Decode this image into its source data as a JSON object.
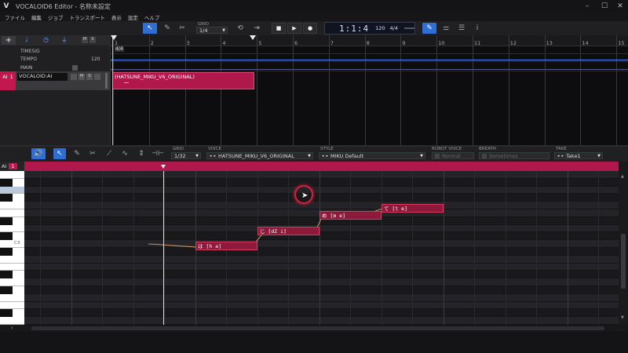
{
  "window": {
    "title": "VOCALOID6 Editor - 名称未設定",
    "logo": "V"
  },
  "menu": [
    "ファイル",
    "編集",
    "ジョブ",
    "トランスポート",
    "表示",
    "設定",
    "ヘルプ"
  ],
  "toolbar": {
    "grid_label": "GRID",
    "grid_value": "1/4",
    "position": "1:1:4",
    "tempo": "120",
    "timesig": "4/4"
  },
  "tracks_panel": {
    "add_label": "+",
    "timesig_label": "TIMESIG",
    "tempo_label": "TEMPO",
    "tempo_value": "120",
    "main_label": "MAIN",
    "track_type": "AI",
    "track_number": "1",
    "track_name": "VOCALOID:AI",
    "btn_mute": "M",
    "btn_solo": "S"
  },
  "timeline": {
    "measures": [
      "1",
      "2",
      "3",
      "4",
      "5",
      "6",
      "7",
      "8",
      "9",
      "10",
      "11",
      "12",
      "13",
      "14",
      "15"
    ],
    "timesig_marker": "4/4",
    "part_name": "(HATSUNE_MIKU_V6_ORIGINAL)"
  },
  "editor_toolbar": {
    "grid_label": "GRID",
    "grid_value": "1/32",
    "voice_label": "VOICE",
    "voice_value": "HATSUNE_MIKU_V6_ORIGINAL",
    "style_label": "STYLE",
    "style_value": "MIKU Default",
    "robot_label": "ROBOT VOICE",
    "robot_value": "Normal",
    "breath_label": "BREATH",
    "breath_value": "Sometimes",
    "take_label": "TAKE",
    "take_value": "Take1"
  },
  "piano_roll": {
    "track_type": "AI",
    "track_number": "1",
    "key_label": "C3",
    "notes": [
      {
        "lyric": "は [h a]"
      },
      {
        "lyric": "じ [dZ i]"
      },
      {
        "lyric": "め [m e]"
      },
      {
        "lyric": "て [t e]"
      }
    ]
  },
  "colors": {
    "accent": "#2f6fd4",
    "note_fill": "#8e1a3b",
    "note_border": "#d23a62",
    "track_part": "#b0174a"
  }
}
